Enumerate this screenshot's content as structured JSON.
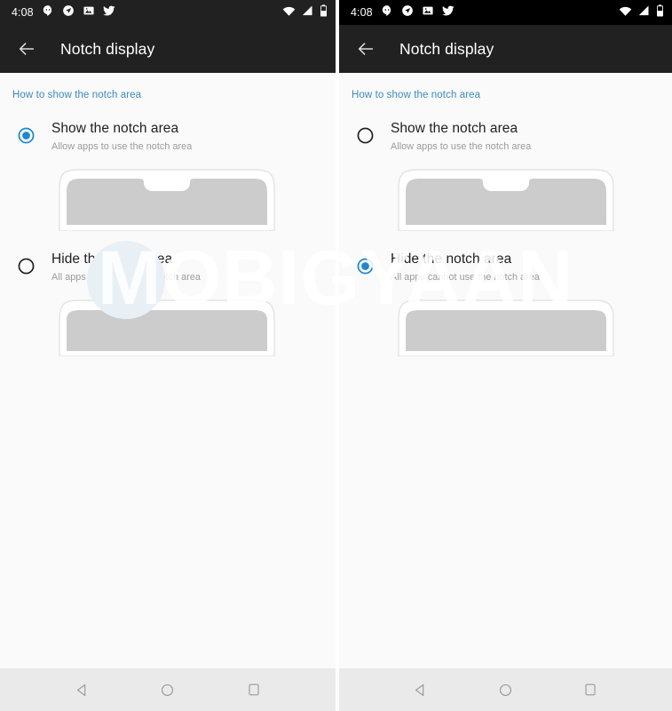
{
  "statusbar": {
    "time": "4:08",
    "left_icons": [
      "hangouts-icon",
      "navigation-icon",
      "photos-icon",
      "twitter-icon"
    ],
    "right_icons": [
      "wifi-icon",
      "cellular-no-signal-icon",
      "battery-icon"
    ]
  },
  "appbar": {
    "back_label": "back-arrow",
    "title": "Notch display"
  },
  "section": {
    "header": "How to show the notch area"
  },
  "options": [
    {
      "key": "show",
      "title": "Show the notch area",
      "subtitle": "Allow apps to use the notch area",
      "preview": "phone-with-notch"
    },
    {
      "key": "hide",
      "title": "Hide the notch area",
      "subtitle": "All apps cannot use the notch area",
      "preview": "phone-without-notch"
    }
  ],
  "panels": [
    {
      "id": "left",
      "selected_option": "show",
      "statusbar_style": "dark"
    },
    {
      "id": "right",
      "selected_option": "hide",
      "statusbar_style": "black"
    }
  ],
  "navbar": {
    "back": "back-triangle-icon",
    "home": "home-circle-icon",
    "recents": "recents-square-icon"
  },
  "watermark": {
    "text": "MOBIGYAAN"
  },
  "colors": {
    "accent_blue": "#1e88d0",
    "section_header_blue": "#3b8bc4",
    "appbar_bg": "#212121",
    "statusbar_black": "#000000",
    "content_bg": "#fafafa",
    "navbar_bg": "#eaeaea",
    "preview_fill": "#cccccc",
    "radio_unselected": "#1c1c1c"
  }
}
